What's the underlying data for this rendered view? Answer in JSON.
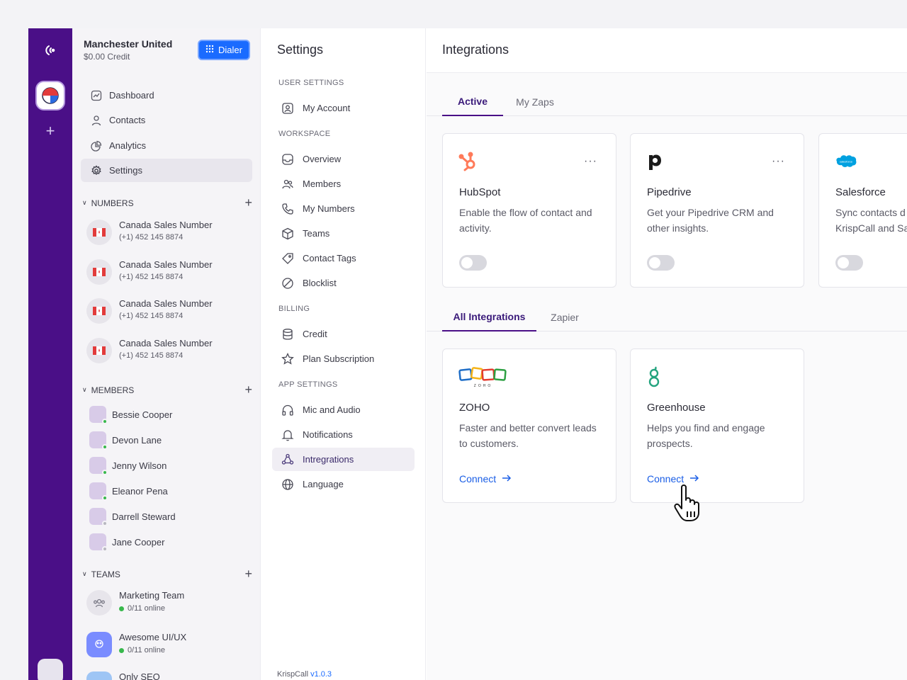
{
  "workspace": {
    "name": "Manchester United",
    "credit": "$0.00 Credit",
    "dialer_label": "Dialer"
  },
  "sidebar": {
    "nav": [
      {
        "label": "Dashboard",
        "icon": "chart-icon"
      },
      {
        "label": "Contacts",
        "icon": "user-icon"
      },
      {
        "label": "Analytics",
        "icon": "pie-icon"
      },
      {
        "label": "Settings",
        "icon": "gear-icon"
      }
    ],
    "numbers_title": "NUMBERS",
    "numbers": [
      {
        "name": "Canada Sales Number",
        "phone": "(+1) 452 145 8874"
      },
      {
        "name": "Canada Sales Number",
        "phone": "(+1) 452 145 8874"
      },
      {
        "name": "Canada Sales Number",
        "phone": "(+1) 452 145 8874"
      },
      {
        "name": "Canada Sales Number",
        "phone": "(+1) 452 145 8874"
      }
    ],
    "members_title": "MEMBERS",
    "members": [
      {
        "name": "Bessie Cooper",
        "status": "online"
      },
      {
        "name": "Devon Lane",
        "status": "online"
      },
      {
        "name": "Jenny Wilson",
        "status": "online"
      },
      {
        "name": "Eleanor Pena",
        "status": "online"
      },
      {
        "name": "Darrell Steward",
        "status": "offline"
      },
      {
        "name": "Jane Cooper",
        "status": "offline"
      }
    ],
    "teams_title": "TEAMS",
    "teams": [
      {
        "name": "Marketing Team",
        "online": "0/11 online"
      },
      {
        "name": "Awesome UI/UX",
        "online": "0/11 online"
      },
      {
        "name": "Only SEO",
        "online": ""
      }
    ]
  },
  "settings": {
    "title": "Settings",
    "user_settings": "USER SETTINGS",
    "my_account": "My Account",
    "workspace": "WORKSPACE",
    "overview": "Overview",
    "members": "Members",
    "my_numbers": "My Numbers",
    "teams": "Teams",
    "contact_tags": "Contact Tags",
    "blocklist": "Blocklist",
    "billing": "BILLING",
    "credit": "Credit",
    "plan_subscription": "Plan Subscription",
    "app_settings": "APP SETTINGS",
    "mic_audio": "Mic and Audio",
    "notifications": "Notifications",
    "integrations": "Intregrations",
    "language": "Language",
    "version_prefix": "KrispCall ",
    "version": "v1.0.3"
  },
  "main": {
    "title": "Integrations",
    "tabs_top": [
      "Active",
      "My Zaps"
    ],
    "active_cards": [
      {
        "name": "HubSpot",
        "desc": "Enable the flow of contact and activity.",
        "enabled": false
      },
      {
        "name": "Pipedrive",
        "desc": "Get your Pipedrive CRM and other insights.",
        "enabled": false
      },
      {
        "name": "Salesforce",
        "desc": "Sync contacts d KrispCall and Sa",
        "enabled": false
      }
    ],
    "tabs_bottom": [
      "All Integrations",
      "Zapier"
    ],
    "all_cards": [
      {
        "name": "ZOHO",
        "desc": "Faster and better convert leads to customers.",
        "action": "Connect"
      },
      {
        "name": "Greenhouse",
        "desc": "Helps you find and engage prospects.",
        "action": "Connect"
      }
    ],
    "zoho_wordmark": "ZOHO",
    "salesforce_wordmark": "salesforce",
    "more_label": "···"
  },
  "colors": {
    "rail": "#4a0f87",
    "primary": "#1a6bff",
    "link": "#1a5ee6",
    "hubspot": "#ff7a59",
    "greenhouse": "#24a47f",
    "salesforce": "#00a1e0"
  }
}
